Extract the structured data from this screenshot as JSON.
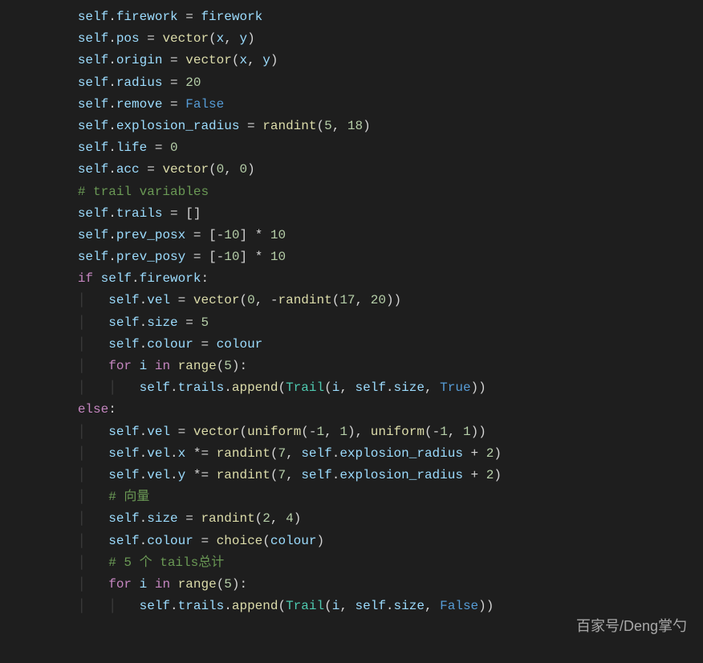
{
  "indent": "    ",
  "guide_char": "│   ",
  "watermark": "百家号/Deng掌勺",
  "lines": [
    {
      "indent": 2,
      "tokens": [
        [
          "self",
          "self"
        ],
        [
          "punc",
          "."
        ],
        [
          "attr",
          "firework"
        ],
        [
          "op",
          " = "
        ],
        [
          "var",
          "firework"
        ]
      ]
    },
    {
      "indent": 2,
      "tokens": [
        [
          "self",
          "self"
        ],
        [
          "punc",
          "."
        ],
        [
          "attr",
          "pos"
        ],
        [
          "op",
          " = "
        ],
        [
          "func",
          "vector"
        ],
        [
          "paren",
          "("
        ],
        [
          "var",
          "x"
        ],
        [
          "punc",
          ", "
        ],
        [
          "var",
          "y"
        ],
        [
          "paren",
          ")"
        ]
      ]
    },
    {
      "indent": 2,
      "tokens": [
        [
          "self",
          "self"
        ],
        [
          "punc",
          "."
        ],
        [
          "attr",
          "origin"
        ],
        [
          "op",
          " = "
        ],
        [
          "func",
          "vector"
        ],
        [
          "paren",
          "("
        ],
        [
          "var",
          "x"
        ],
        [
          "punc",
          ", "
        ],
        [
          "var",
          "y"
        ],
        [
          "paren",
          ")"
        ]
      ]
    },
    {
      "indent": 2,
      "tokens": [
        [
          "self",
          "self"
        ],
        [
          "punc",
          "."
        ],
        [
          "attr",
          "radius"
        ],
        [
          "op",
          " = "
        ],
        [
          "num",
          "20"
        ]
      ]
    },
    {
      "indent": 2,
      "tokens": [
        [
          "self",
          "self"
        ],
        [
          "punc",
          "."
        ],
        [
          "attr",
          "remove"
        ],
        [
          "op",
          " = "
        ],
        [
          "kwblue",
          "False"
        ]
      ]
    },
    {
      "indent": 2,
      "tokens": [
        [
          "self",
          "self"
        ],
        [
          "punc",
          "."
        ],
        [
          "attr",
          "explosion_radius"
        ],
        [
          "op",
          " = "
        ],
        [
          "func",
          "randint"
        ],
        [
          "paren",
          "("
        ],
        [
          "num",
          "5"
        ],
        [
          "punc",
          ", "
        ],
        [
          "num",
          "18"
        ],
        [
          "paren",
          ")"
        ]
      ]
    },
    {
      "indent": 2,
      "tokens": [
        [
          "self",
          "self"
        ],
        [
          "punc",
          "."
        ],
        [
          "attr",
          "life"
        ],
        [
          "op",
          " = "
        ],
        [
          "num",
          "0"
        ]
      ]
    },
    {
      "indent": 2,
      "tokens": [
        [
          "self",
          "self"
        ],
        [
          "punc",
          "."
        ],
        [
          "attr",
          "acc"
        ],
        [
          "op",
          " = "
        ],
        [
          "func",
          "vector"
        ],
        [
          "paren",
          "("
        ],
        [
          "num",
          "0"
        ],
        [
          "punc",
          ", "
        ],
        [
          "num",
          "0"
        ],
        [
          "paren",
          ")"
        ]
      ]
    },
    {
      "indent": 2,
      "tokens": [
        [
          "comment",
          "# trail variables"
        ]
      ]
    },
    {
      "indent": 2,
      "tokens": [
        [
          "self",
          "self"
        ],
        [
          "punc",
          "."
        ],
        [
          "attr",
          "trails"
        ],
        [
          "op",
          " = "
        ],
        [
          "bracket",
          "[]"
        ]
      ]
    },
    {
      "indent": 2,
      "tokens": [
        [
          "self",
          "self"
        ],
        [
          "punc",
          "."
        ],
        [
          "attr",
          "prev_posx"
        ],
        [
          "op",
          " = "
        ],
        [
          "bracket",
          "["
        ],
        [
          "op",
          "-"
        ],
        [
          "num",
          "10"
        ],
        [
          "bracket",
          "]"
        ],
        [
          "op",
          " * "
        ],
        [
          "num",
          "10"
        ]
      ]
    },
    {
      "indent": 2,
      "tokens": [
        [
          "self",
          "self"
        ],
        [
          "punc",
          "."
        ],
        [
          "attr",
          "prev_posy"
        ],
        [
          "op",
          " = "
        ],
        [
          "bracket",
          "["
        ],
        [
          "op",
          "-"
        ],
        [
          "num",
          "10"
        ],
        [
          "bracket",
          "]"
        ],
        [
          "op",
          " * "
        ],
        [
          "num",
          "10"
        ]
      ]
    },
    {
      "indent": 0,
      "tokens": []
    },
    {
      "indent": 2,
      "tokens": [
        [
          "kw",
          "if"
        ],
        [
          "op",
          " "
        ],
        [
          "self",
          "self"
        ],
        [
          "punc",
          "."
        ],
        [
          "attr",
          "firework"
        ],
        [
          "punc",
          ":"
        ]
      ]
    },
    {
      "indent": 2,
      "guides": 1,
      "tokens": [
        [
          "self",
          "self"
        ],
        [
          "punc",
          "."
        ],
        [
          "attr",
          "vel"
        ],
        [
          "op",
          " = "
        ],
        [
          "func",
          "vector"
        ],
        [
          "paren",
          "("
        ],
        [
          "num",
          "0"
        ],
        [
          "punc",
          ", "
        ],
        [
          "op",
          "-"
        ],
        [
          "func",
          "randint"
        ],
        [
          "paren",
          "("
        ],
        [
          "num",
          "17"
        ],
        [
          "punc",
          ", "
        ],
        [
          "num",
          "20"
        ],
        [
          "paren",
          "))"
        ]
      ]
    },
    {
      "indent": 2,
      "guides": 1,
      "tokens": [
        [
          "self",
          "self"
        ],
        [
          "punc",
          "."
        ],
        [
          "attr",
          "size"
        ],
        [
          "op",
          " = "
        ],
        [
          "num",
          "5"
        ]
      ]
    },
    {
      "indent": 2,
      "guides": 1,
      "tokens": [
        [
          "self",
          "self"
        ],
        [
          "punc",
          "."
        ],
        [
          "attr",
          "colour"
        ],
        [
          "op",
          " = "
        ],
        [
          "var",
          "colour"
        ]
      ]
    },
    {
      "indent": 2,
      "guides": 1,
      "tokens": [
        [
          "kw",
          "for"
        ],
        [
          "op",
          " "
        ],
        [
          "var",
          "i"
        ],
        [
          "op",
          " "
        ],
        [
          "kw",
          "in"
        ],
        [
          "op",
          " "
        ],
        [
          "func",
          "range"
        ],
        [
          "paren",
          "("
        ],
        [
          "num",
          "5"
        ],
        [
          "paren",
          ")"
        ],
        [
          "punc",
          ":"
        ]
      ]
    },
    {
      "indent": 2,
      "guides": 2,
      "tokens": [
        [
          "self",
          "self"
        ],
        [
          "punc",
          "."
        ],
        [
          "attr",
          "trails"
        ],
        [
          "punc",
          "."
        ],
        [
          "func",
          "append"
        ],
        [
          "paren",
          "("
        ],
        [
          "class",
          "Trail"
        ],
        [
          "paren",
          "("
        ],
        [
          "var",
          "i"
        ],
        [
          "punc",
          ", "
        ],
        [
          "self",
          "self"
        ],
        [
          "punc",
          "."
        ],
        [
          "attr",
          "size"
        ],
        [
          "punc",
          ", "
        ],
        [
          "kwblue",
          "True"
        ],
        [
          "paren",
          "))"
        ]
      ]
    },
    {
      "indent": 2,
      "tokens": [
        [
          "kw",
          "else"
        ],
        [
          "punc",
          ":"
        ]
      ]
    },
    {
      "indent": 2,
      "guides": 1,
      "tokens": [
        [
          "self",
          "self"
        ],
        [
          "punc",
          "."
        ],
        [
          "attr",
          "vel"
        ],
        [
          "op",
          " = "
        ],
        [
          "func",
          "vector"
        ],
        [
          "paren",
          "("
        ],
        [
          "func",
          "uniform"
        ],
        [
          "paren",
          "("
        ],
        [
          "op",
          "-"
        ],
        [
          "num",
          "1"
        ],
        [
          "punc",
          ", "
        ],
        [
          "num",
          "1"
        ],
        [
          "paren",
          ")"
        ],
        [
          "punc",
          ", "
        ],
        [
          "func",
          "uniform"
        ],
        [
          "paren",
          "("
        ],
        [
          "op",
          "-"
        ],
        [
          "num",
          "1"
        ],
        [
          "punc",
          ", "
        ],
        [
          "num",
          "1"
        ],
        [
          "paren",
          "))"
        ]
      ]
    },
    {
      "indent": 2,
      "guides": 1,
      "tokens": [
        [
          "self",
          "self"
        ],
        [
          "punc",
          "."
        ],
        [
          "attr",
          "vel"
        ],
        [
          "punc",
          "."
        ],
        [
          "attr",
          "x"
        ],
        [
          "op",
          " *= "
        ],
        [
          "func",
          "randint"
        ],
        [
          "paren",
          "("
        ],
        [
          "num",
          "7"
        ],
        [
          "punc",
          ", "
        ],
        [
          "self",
          "self"
        ],
        [
          "punc",
          "."
        ],
        [
          "attr",
          "explosion_radius"
        ],
        [
          "op",
          " + "
        ],
        [
          "num",
          "2"
        ],
        [
          "paren",
          ")"
        ]
      ]
    },
    {
      "indent": 2,
      "guides": 1,
      "tokens": [
        [
          "self",
          "self"
        ],
        [
          "punc",
          "."
        ],
        [
          "attr",
          "vel"
        ],
        [
          "punc",
          "."
        ],
        [
          "attr",
          "y"
        ],
        [
          "op",
          " *= "
        ],
        [
          "func",
          "randint"
        ],
        [
          "paren",
          "("
        ],
        [
          "num",
          "7"
        ],
        [
          "punc",
          ", "
        ],
        [
          "self",
          "self"
        ],
        [
          "punc",
          "."
        ],
        [
          "attr",
          "explosion_radius"
        ],
        [
          "op",
          " + "
        ],
        [
          "num",
          "2"
        ],
        [
          "paren",
          ")"
        ]
      ]
    },
    {
      "indent": 2,
      "guides": 1,
      "tokens": [
        [
          "comment",
          "# 向量"
        ]
      ]
    },
    {
      "indent": 2,
      "guides": 1,
      "tokens": [
        [
          "self",
          "self"
        ],
        [
          "punc",
          "."
        ],
        [
          "attr",
          "size"
        ],
        [
          "op",
          " = "
        ],
        [
          "func",
          "randint"
        ],
        [
          "paren",
          "("
        ],
        [
          "num",
          "2"
        ],
        [
          "punc",
          ", "
        ],
        [
          "num",
          "4"
        ],
        [
          "paren",
          ")"
        ]
      ]
    },
    {
      "indent": 2,
      "guides": 1,
      "tokens": [
        [
          "self",
          "self"
        ],
        [
          "punc",
          "."
        ],
        [
          "attr",
          "colour"
        ],
        [
          "op",
          " = "
        ],
        [
          "func",
          "choice"
        ],
        [
          "paren",
          "("
        ],
        [
          "var",
          "colour"
        ],
        [
          "paren",
          ")"
        ]
      ]
    },
    {
      "indent": 2,
      "guides": 1,
      "tokens": [
        [
          "comment",
          "# 5 个 tails总计"
        ]
      ]
    },
    {
      "indent": 2,
      "guides": 1,
      "tokens": [
        [
          "kw",
          "for"
        ],
        [
          "op",
          " "
        ],
        [
          "var",
          "i"
        ],
        [
          "op",
          " "
        ],
        [
          "kw",
          "in"
        ],
        [
          "op",
          " "
        ],
        [
          "func",
          "range"
        ],
        [
          "paren",
          "("
        ],
        [
          "num",
          "5"
        ],
        [
          "paren",
          ")"
        ],
        [
          "punc",
          ":"
        ]
      ]
    },
    {
      "indent": 2,
      "guides": 2,
      "tokens": [
        [
          "self",
          "self"
        ],
        [
          "punc",
          "."
        ],
        [
          "attr",
          "trails"
        ],
        [
          "punc",
          "."
        ],
        [
          "func",
          "append"
        ],
        [
          "paren",
          "("
        ],
        [
          "class",
          "Trail"
        ],
        [
          "paren",
          "("
        ],
        [
          "var",
          "i"
        ],
        [
          "punc",
          ", "
        ],
        [
          "self",
          "self"
        ],
        [
          "punc",
          "."
        ],
        [
          "attr",
          "size"
        ],
        [
          "punc",
          ", "
        ],
        [
          "kwblue",
          "False"
        ],
        [
          "paren",
          "))"
        ]
      ]
    }
  ]
}
